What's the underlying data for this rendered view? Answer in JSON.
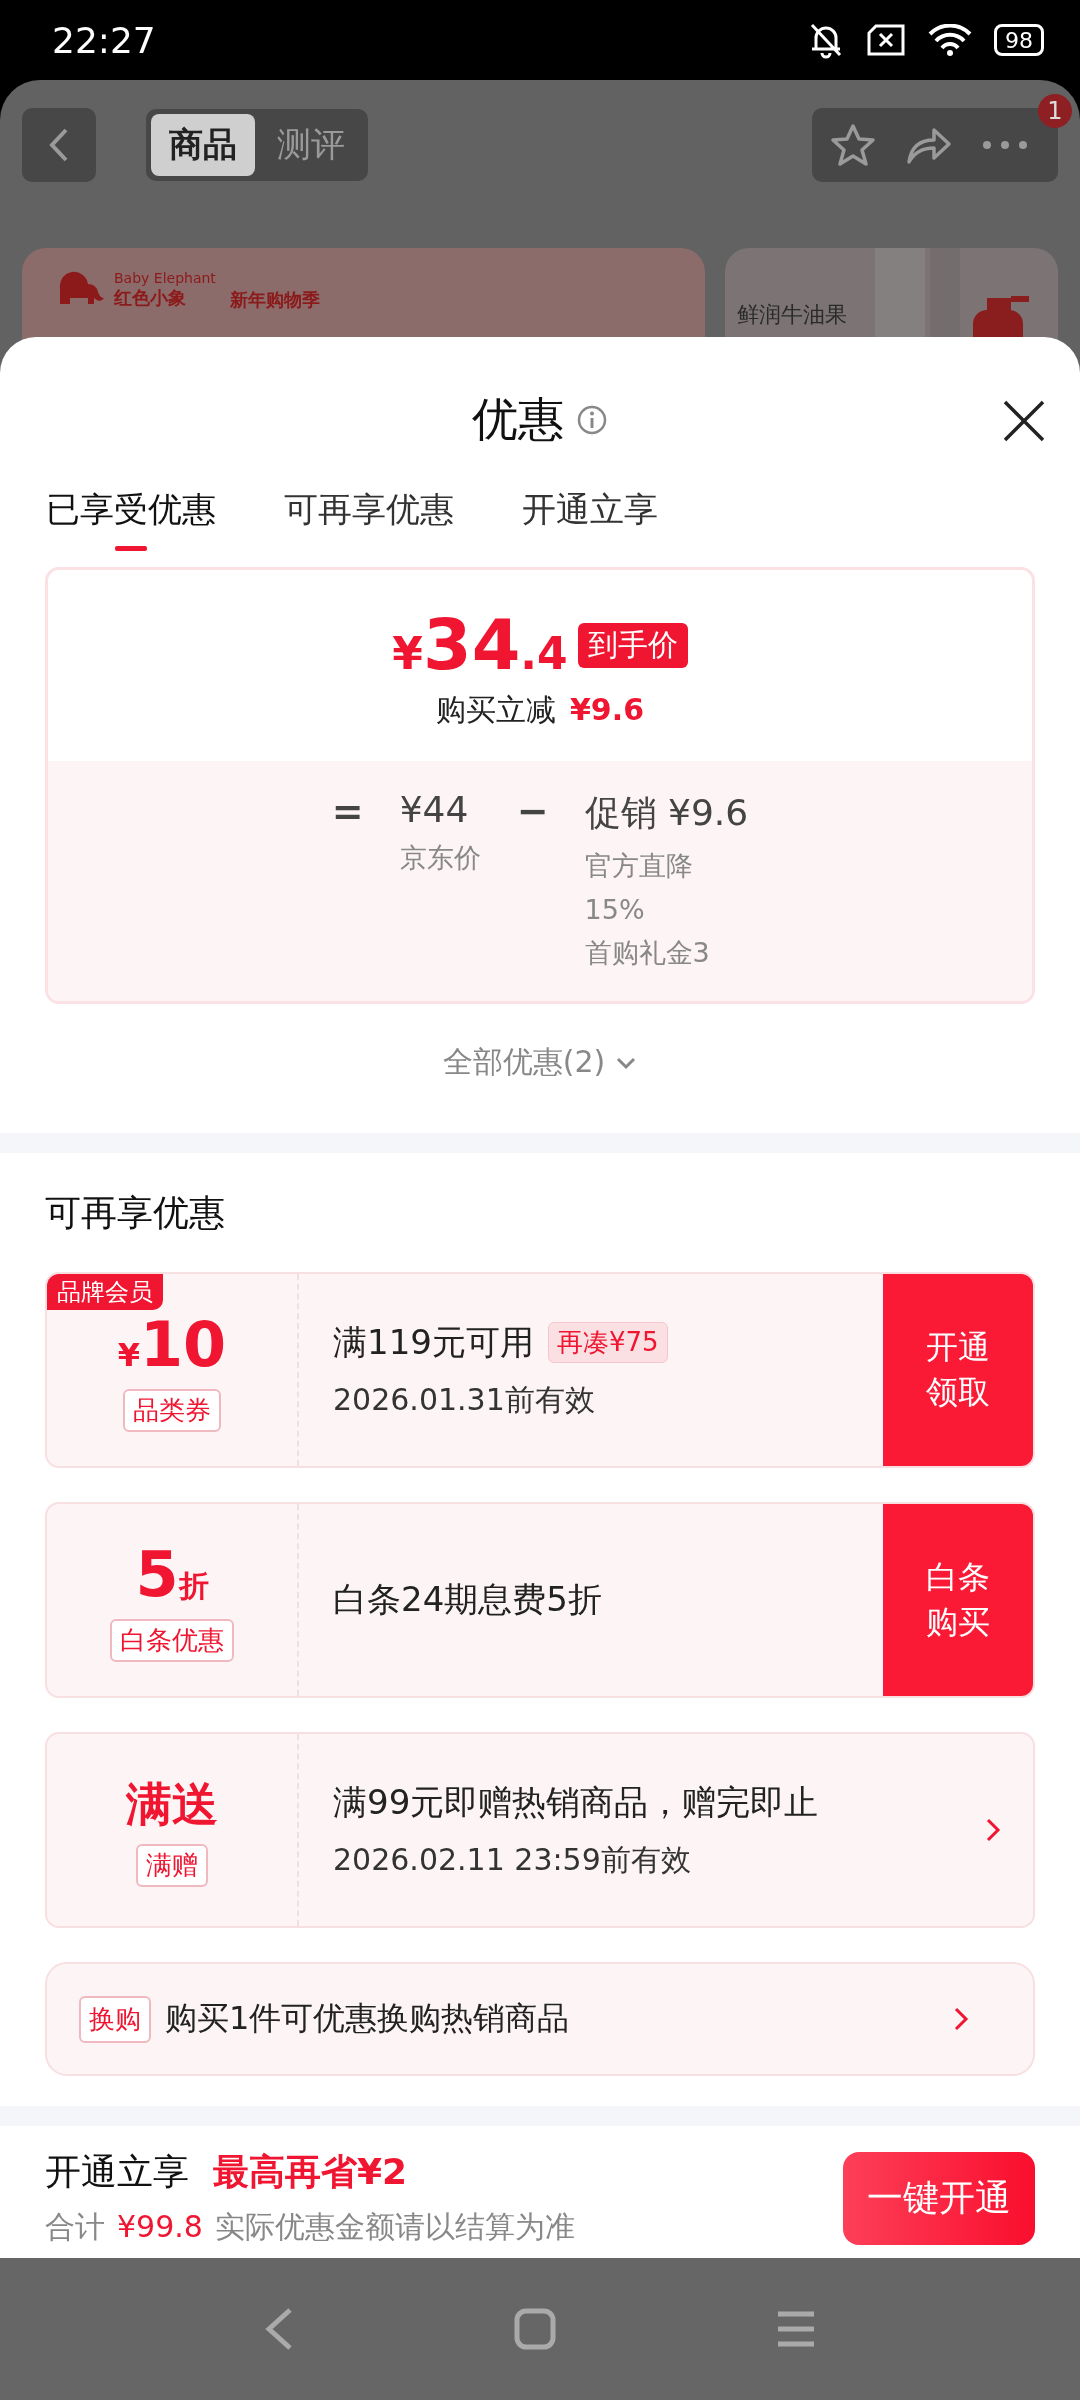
{
  "status_bar": {
    "time": "22:27",
    "battery": "98"
  },
  "page": {
    "tabs": [
      {
        "label": "商品",
        "selected": true
      },
      {
        "label": "测评",
        "selected": false
      }
    ],
    "more_badge": "1",
    "banner": {
      "brand_en": "Baby Elephant",
      "brand_cn": "红色小象",
      "campaign": "新年购物季"
    },
    "side_card": {
      "title": "鲜润牛油果"
    }
  },
  "sheet": {
    "title": "优惠",
    "tabs": [
      {
        "label": "已享受优惠",
        "selected": true
      },
      {
        "label": "可再享优惠",
        "selected": false
      },
      {
        "label": "开通立享",
        "selected": false
      }
    ],
    "summary": {
      "price_symbol": "¥",
      "price_int": "34",
      "price_dec": ".4",
      "price_tag": "到手价",
      "reduction_label": "购买立减",
      "reduction_value": "¥9.6",
      "equals": "=",
      "base_price": "¥44",
      "base_label": "京东价",
      "minus": "−",
      "promo_label": "促销 ¥9.6",
      "promo_details": [
        "官方直降",
        "15%",
        "首购礼金3"
      ]
    },
    "all_link": "全部优惠(2)"
  },
  "more_offers": {
    "title": "可再享优惠",
    "coupons": [
      {
        "kind": "currency",
        "corner_tag": "品牌会员",
        "value_prefix": "¥",
        "value": "10",
        "type_label": "品类券",
        "title": "满119元可用",
        "hint": "再凑¥75",
        "validity": "2026.01.31前有效",
        "action": "开通领取"
      },
      {
        "kind": "discount",
        "value": "5",
        "value_suffix": "折",
        "type_label": "白条优惠",
        "title": "白条24期息费5折",
        "action": "白条购买"
      },
      {
        "kind": "gift",
        "value": "满送",
        "type_label": "满赠",
        "title": "满99元即赠热销商品，赠完即止",
        "validity": "2026.02.11 23:59前有效"
      }
    ],
    "swap": {
      "tag": "换购",
      "text": "购买1件可优惠换购热销商品"
    }
  },
  "footer": {
    "title": "开通立享",
    "highlight": "最高再省¥2",
    "total_label": "合计",
    "total_value": "¥99.8",
    "note": "实际优惠金额请以结算为准",
    "button": "一键开通"
  }
}
